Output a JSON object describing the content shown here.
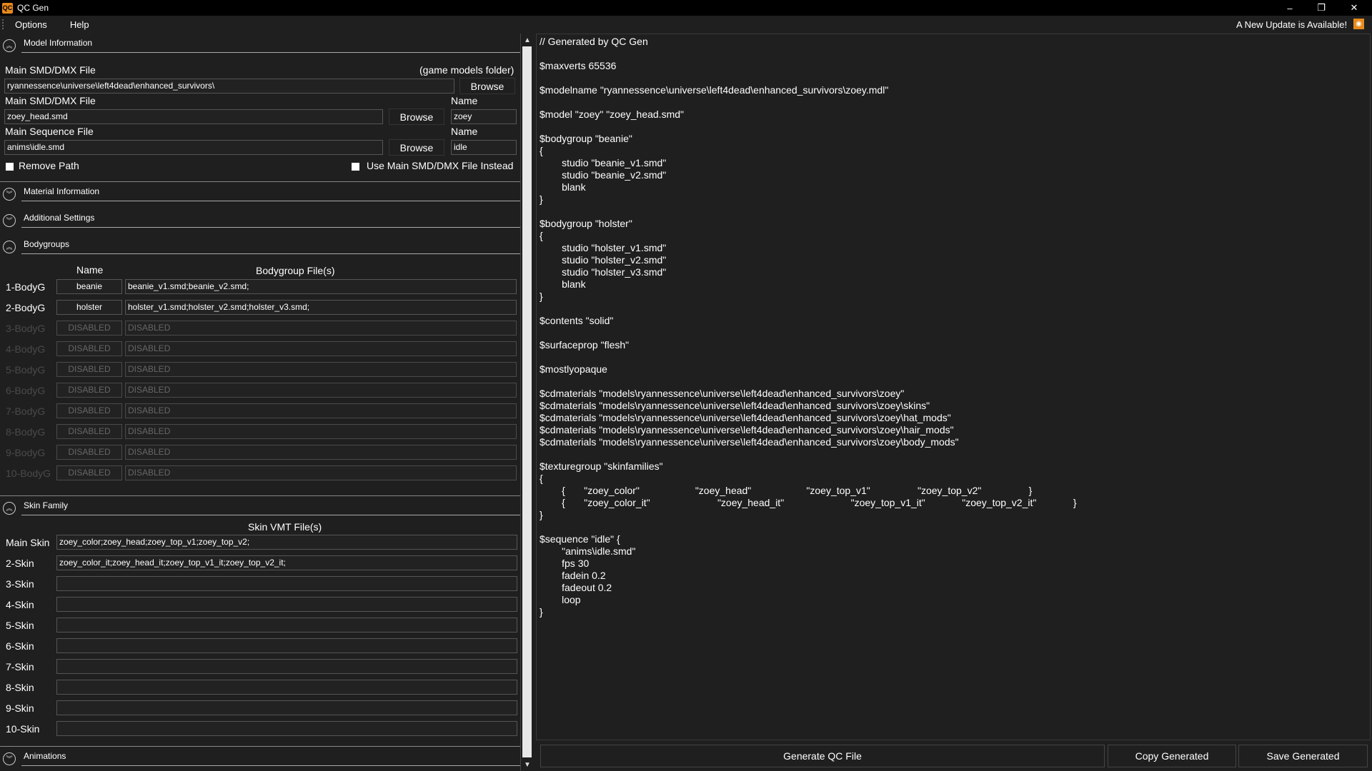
{
  "window": {
    "title": "QC Gen",
    "icon_text": "QC",
    "minimize": "–",
    "maximize": "❐",
    "close": "✕"
  },
  "menu": {
    "items": [
      "Options",
      "Help"
    ],
    "update_notice": "A New Update is Available!",
    "update_icon": "rss-icon"
  },
  "model_info": {
    "title": "Model Information",
    "toggle": "︽",
    "main_file_label": "Main SMD/DMX File",
    "game_models_hint": "(game models folder)",
    "path_value": "ryannessence\\universe\\left4dead\\enhanced_survivors\\",
    "browse": "Browse",
    "smd_label": "Main SMD/DMX File",
    "smd_value": "zoey_head.smd",
    "name_label": "Name",
    "name_value": "zoey",
    "seq_label": "Main Sequence File",
    "seq_value": "anims\\idle.smd",
    "seq_name_label": "Name",
    "seq_name_value": "idle",
    "remove_path": "Remove Path",
    "use_main": "Use Main SMD/DMX File Instead"
  },
  "material_info": {
    "title": "Material Information",
    "toggle": "︾"
  },
  "additional": {
    "title": "Additional Settings",
    "toggle": "︾"
  },
  "bodygroups": {
    "title": "Bodygroups",
    "toggle": "︽",
    "col_name": "Name",
    "col_files": "Bodygroup File(s)",
    "rows": [
      {
        "label": "1-BodyG",
        "name": "beanie",
        "files": "beanie_v1.smd;beanie_v2.smd;",
        "enabled": true
      },
      {
        "label": "2-BodyG",
        "name": "holster",
        "files": "holster_v1.smd;holster_v2.smd;holster_v3.smd;",
        "enabled": true
      },
      {
        "label": "3-BodyG",
        "name": "DISABLED",
        "files": "DISABLED",
        "enabled": false
      },
      {
        "label": "4-BodyG",
        "name": "DISABLED",
        "files": "DISABLED",
        "enabled": false
      },
      {
        "label": "5-BodyG",
        "name": "DISABLED",
        "files": "DISABLED",
        "enabled": false
      },
      {
        "label": "6-BodyG",
        "name": "DISABLED",
        "files": "DISABLED",
        "enabled": false
      },
      {
        "label": "7-BodyG",
        "name": "DISABLED",
        "files": "DISABLED",
        "enabled": false
      },
      {
        "label": "8-BodyG",
        "name": "DISABLED",
        "files": "DISABLED",
        "enabled": false
      },
      {
        "label": "9-BodyG",
        "name": "DISABLED",
        "files": "DISABLED",
        "enabled": false
      },
      {
        "label": "10-BodyG",
        "name": "DISABLED",
        "files": "DISABLED",
        "enabled": false
      }
    ]
  },
  "skin_family": {
    "title": "Skin Family",
    "toggle": "︽",
    "col_files": "Skin VMT File(s)",
    "rows": [
      {
        "label": "Main Skin",
        "value": "zoey_color;zoey_head;zoey_top_v1;zoey_top_v2;"
      },
      {
        "label": "2-Skin",
        "value": "zoey_color_it;zoey_head_it;zoey_top_v1_it;zoey_top_v2_it;"
      },
      {
        "label": "3-Skin",
        "value": ""
      },
      {
        "label": "4-Skin",
        "value": ""
      },
      {
        "label": "5-Skin",
        "value": ""
      },
      {
        "label": "6-Skin",
        "value": ""
      },
      {
        "label": "7-Skin",
        "value": ""
      },
      {
        "label": "8-Skin",
        "value": ""
      },
      {
        "label": "9-Skin",
        "value": ""
      },
      {
        "label": "10-Skin",
        "value": ""
      }
    ]
  },
  "animations": {
    "title": "Animations",
    "toggle": "︾"
  },
  "scroll": {
    "up": "▲",
    "down": "▼"
  },
  "generated_code": "// Generated by QC Gen\n\n$maxverts 65536\n\n$modelname \"ryannessence\\universe\\left4dead\\enhanced_survivors\\zoey.mdl\"\n\n$model \"zoey\" \"zoey_head.smd\"\n\n$bodygroup \"beanie\"\n{\n\tstudio \"beanie_v1.smd\"\n\tstudio \"beanie_v2.smd\"\n\tblank\n}\n\n$bodygroup \"holster\"\n{\n\tstudio \"holster_v1.smd\"\n\tstudio \"holster_v2.smd\"\n\tstudio \"holster_v3.smd\"\n\tblank\n}\n\n$contents \"solid\"\n\n$surfaceprop \"flesh\"\n\n$mostlyopaque\n\n$cdmaterials \"models\\ryannessence\\universe\\left4dead\\enhanced_survivors\\zoey\"\n$cdmaterials \"models\\ryannessence\\universe\\left4dead\\enhanced_survivors\\zoey\\skins\"\n$cdmaterials \"models\\ryannessence\\universe\\left4dead\\enhanced_survivors\\zoey\\hat_mods\"\n$cdmaterials \"models\\ryannessence\\universe\\left4dead\\enhanced_survivors\\zoey\\hair_mods\"\n$cdmaterials \"models\\ryannessence\\universe\\left4dead\\enhanced_survivors\\zoey\\body_mods\"\n\n$texturegroup \"skinfamilies\"\n{\n\t{\t\"zoey_color\"\t\t\t\"zoey_head\"\t\t\t\"zoey_top_v1\"\t\t\t\"zoey_top_v2\"\t\t\t}\n\t{\t\"zoey_color_it\"\t\t\t\"zoey_head_it\"\t\t\t\"zoey_top_v1_it\"\t\t\"zoey_top_v2_it\"\t\t}\n}\n\n$sequence \"idle\" {\n\t\"anims\\idle.smd\"\n\tfps 30\n\tfadein 0.2\n\tfadeout 0.2\n\tloop\n}",
  "actions": {
    "generate": "Generate QC File",
    "copy": "Copy Generated",
    "save": "Save Generated"
  }
}
